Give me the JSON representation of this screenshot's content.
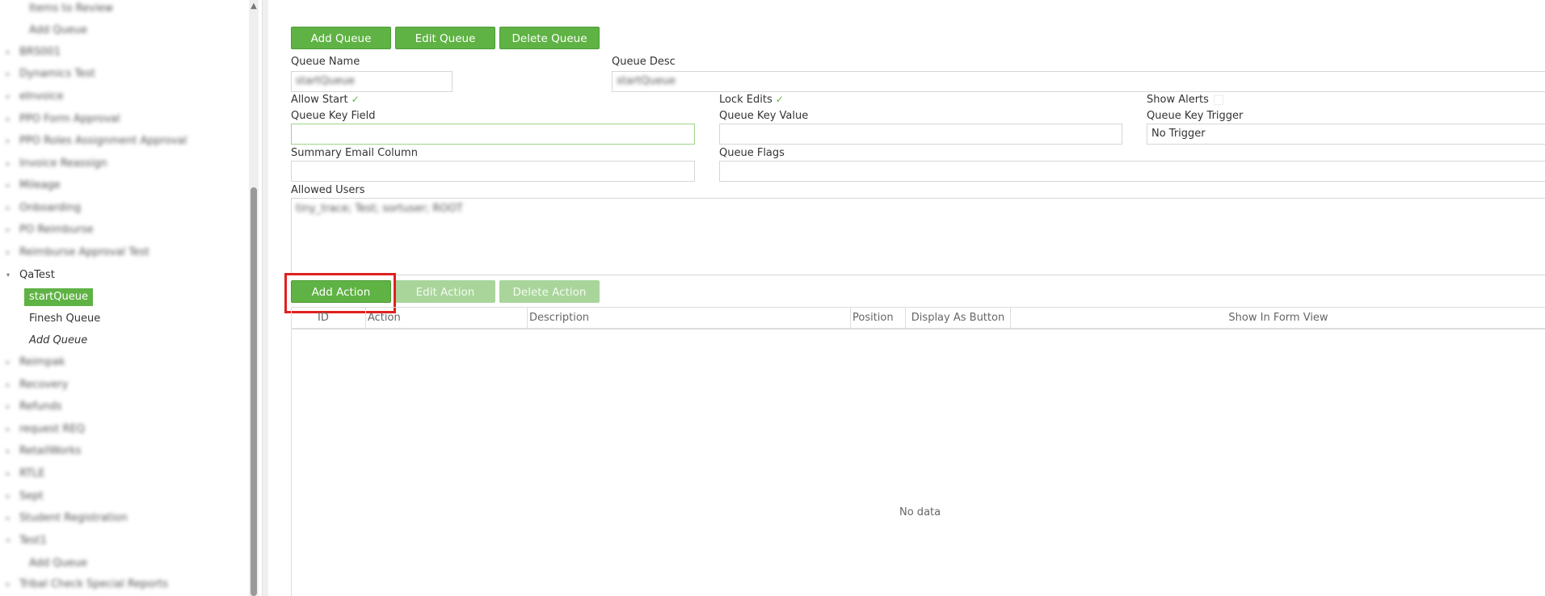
{
  "sidebar": {
    "items": [
      {
        "label": "Items to Review",
        "blurred": true,
        "child": true
      },
      {
        "label": "Add Queue",
        "blurred": true,
        "child": true
      },
      {
        "label": "BRS001",
        "blurred": true
      },
      {
        "label": "Dynamics Test",
        "blurred": true
      },
      {
        "label": "eInvoice",
        "blurred": true
      },
      {
        "label": "PPO Form Approval",
        "blurred": true
      },
      {
        "label": "PPO Roles Assignment Approval",
        "blurred": true
      },
      {
        "label": "Invoice Reassign",
        "blurred": true
      },
      {
        "label": "Mileage",
        "blurred": true
      },
      {
        "label": "Onboarding",
        "blurred": true
      },
      {
        "label": "PO Reimburse",
        "blurred": true
      },
      {
        "label": "Reimburse Approval Test",
        "blurred": true
      },
      {
        "label": "QaTest",
        "blurred": false,
        "expanded": true
      },
      {
        "label": "startQueue",
        "blurred": false,
        "child": true,
        "selected": true
      },
      {
        "label": "Finesh Queue",
        "blurred": false,
        "child": true
      },
      {
        "label": "Add Queue",
        "blurred": false,
        "child": true,
        "italic": true
      },
      {
        "label": "Reimpak",
        "blurred": true
      },
      {
        "label": "Recovery",
        "blurred": true
      },
      {
        "label": "Refunds",
        "blurred": true
      },
      {
        "label": "request REQ",
        "blurred": true
      },
      {
        "label": "RetailWorks",
        "blurred": true
      },
      {
        "label": "RTLE",
        "blurred": true
      },
      {
        "label": "Sept",
        "blurred": true
      },
      {
        "label": "Student Registration",
        "blurred": true
      },
      {
        "label": "Test1",
        "blurred": true
      },
      {
        "label": "Add Queue",
        "blurred": true,
        "child": true
      },
      {
        "label": "Tribal Check Special Reports",
        "blurred": true
      }
    ]
  },
  "toolbar": {
    "add_queue": "Add Queue",
    "edit_queue": "Edit Queue",
    "delete_queue": "Delete Queue"
  },
  "form": {
    "queue_name_label": "Queue Name",
    "queue_name_value": "startQueue",
    "queue_desc_label": "Queue Desc",
    "queue_desc_value": "startQueue",
    "allow_start_label": "Allow Start",
    "allow_start_checked": true,
    "lock_edits_label": "Lock Edits",
    "lock_edits_checked": true,
    "show_alerts_label": "Show Alerts",
    "show_alerts_checked": false,
    "queue_key_field_label": "Queue Key Field",
    "queue_key_field_value": "",
    "queue_key_value_label": "Queue Key Value",
    "queue_key_value_value": "",
    "queue_key_trigger_label": "Queue Key Trigger",
    "queue_key_trigger_value": "No Trigger",
    "summary_email_label": "Summary Email Column",
    "summary_email_value": "",
    "queue_flags_label": "Queue Flags",
    "queue_flags_value": "",
    "allowed_users_label": "Allowed Users",
    "allowed_users_value": "tiny_trace; Test; sortuser; ROOT"
  },
  "actions": {
    "add_action": "Add Action",
    "edit_action": "Edit Action",
    "delete_action": "Delete Action"
  },
  "grid": {
    "columns": [
      "ID",
      "Action",
      "Description",
      "Position",
      "Display As Button",
      "Show In Form View"
    ],
    "empty_text": "No data"
  },
  "colors": {
    "accent": "#5fb244",
    "disabled": "#a9d59b",
    "highlight": "#e02020"
  }
}
